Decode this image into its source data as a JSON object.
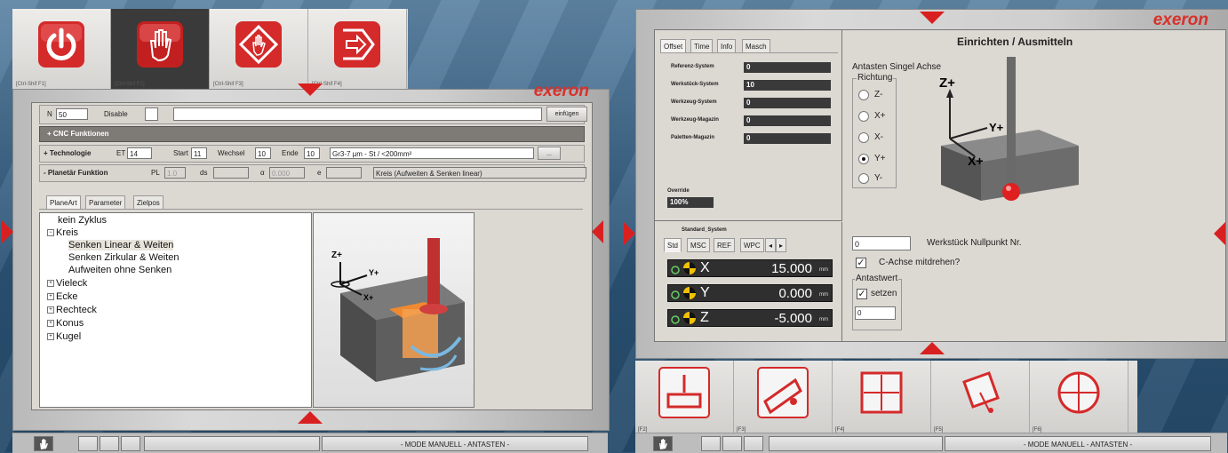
{
  "left": {
    "fkeys": [
      "[Ctrl-Shif F1]",
      "[Ctrl-Shif F2]",
      "[Ctrl-Shif F3]",
      "[Ctrl-Shif F4]"
    ],
    "brand": "exeron",
    "n_label": "N",
    "n_value": "50",
    "disable_label": "Disable",
    "insert_button": "einfügen",
    "cnc_section": "+ CNC Funktionen",
    "tech": {
      "title": "+ Technologie",
      "et_label": "ET",
      "et_value": "14",
      "start_label": "Start",
      "start_value": "11",
      "wechsel_label": "Wechsel",
      "wechsel_value": "10",
      "ende_label": "Ende",
      "ende_value": "10",
      "material": "Gr3-7 µm - St / <200mm²",
      "more_button": "..."
    },
    "planet": {
      "title": "- Planetär Funktion",
      "pl_label": "PL",
      "pl_value": "1.0",
      "ds_label": "ds",
      "alpha_label": "α",
      "alpha_value": "0.000",
      "e_label": "e",
      "description": "Kreis (Aufweiten & Senken linear)"
    },
    "tabs": [
      "PlaneArt",
      "Parameter",
      "Zielpos"
    ],
    "tree": [
      "kein Zyklus",
      "Kreis",
      "Senken Linear & Weiten",
      "Senken Zirkular & Weiten",
      "Aufweiten ohne Senken",
      "Vieleck",
      "Ecke",
      "Rechteck",
      "Konus",
      "Kugel"
    ],
    "axis_labels": {
      "z": "Z+",
      "y": "Y+",
      "x": "X+"
    },
    "status_mode": "- MODE MANUELL - ANTASTEN -"
  },
  "right": {
    "brand": "exeron",
    "tabs": [
      "Offset",
      "Time",
      "Info",
      "Masch"
    ],
    "offsets": [
      {
        "label": "Referenz-System",
        "value": "0"
      },
      {
        "label": "Werkstück-System",
        "value": "10"
      },
      {
        "label": "Werkzeug-System",
        "value": "0"
      },
      {
        "label": "Werkzeug-Magazin",
        "value": "0"
      },
      {
        "label": "Paletten-Magazin",
        "value": "0"
      }
    ],
    "override_label": "Override",
    "override_value": "100%",
    "std_system_title": "Standard_System",
    "sys_tabs": [
      "Std",
      "MSC",
      "REF",
      "WPC"
    ],
    "axes": [
      {
        "name": "X",
        "value": "15.000",
        "unit": "mm"
      },
      {
        "name": "Y",
        "value": "0.000",
        "unit": "mm"
      },
      {
        "name": "Z",
        "value": "-5.000",
        "unit": "mm"
      }
    ],
    "panel_title": "Einrichten / Ausmitteln",
    "probe_title": "Antasten Singel Achse",
    "direction_label": "Richtung",
    "directions": [
      "Z-",
      "X+",
      "X-",
      "Y+",
      "Y-"
    ],
    "selected_direction": "Y+",
    "axis_labels": {
      "z": "Z+",
      "y": "Y+",
      "x": "X+"
    },
    "nullpunkt_value": "0",
    "nullpunkt_label": "Werkstück Nullpunkt Nr.",
    "c_axis_label": "C-Achse mitdrehen?",
    "antastwert_label": "Antastwert",
    "setzen_label": "setzen",
    "antastwert_value": "0",
    "fkeys": [
      "[F2]",
      "[F3]",
      "[F4]",
      "[F5]",
      "[F6]"
    ],
    "status_mode": "- MODE MANUELL - ANTASTEN -"
  }
}
